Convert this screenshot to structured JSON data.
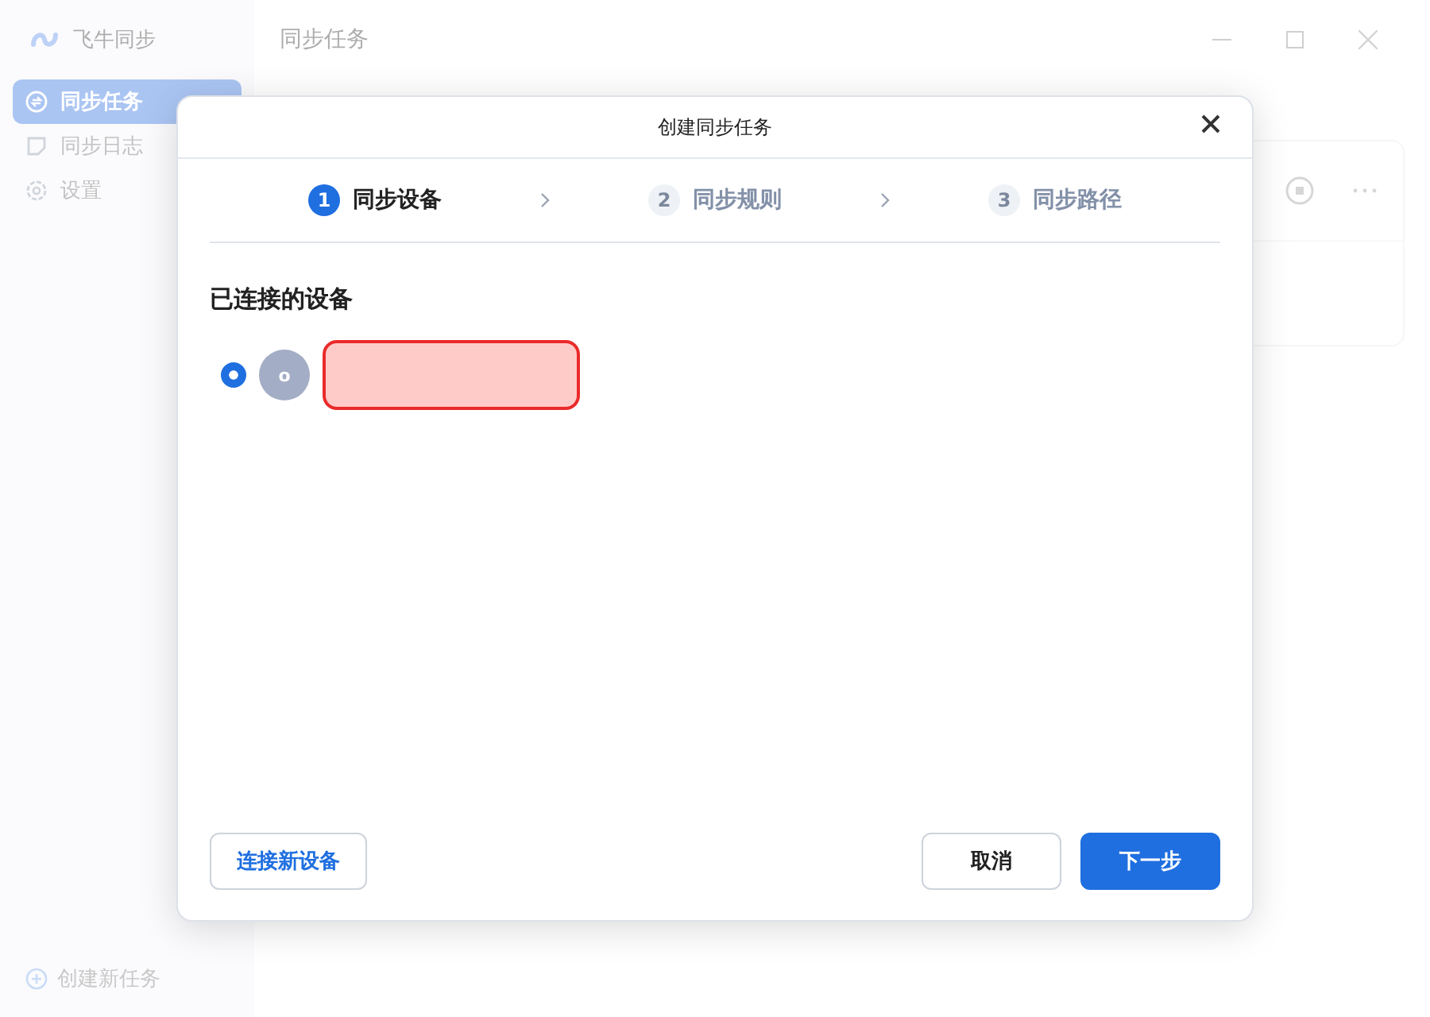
{
  "app": {
    "name": "飞牛同步"
  },
  "sidebar": {
    "items": [
      {
        "kind": "tasks",
        "label": "同步任务",
        "selected": true
      },
      {
        "kind": "log",
        "label": "同步日志",
        "selected": false
      },
      {
        "kind": "settings",
        "label": "设置",
        "selected": false
      }
    ],
    "create_button": "创建新任务"
  },
  "page": {
    "title": "同步任务"
  },
  "dialog": {
    "title": "创建同步任务",
    "steps": [
      {
        "number": "1",
        "label": "同步设备",
        "selected": true
      },
      {
        "number": "2",
        "label": "同步规则",
        "selected": false
      },
      {
        "number": "3",
        "label": "同步路径",
        "selected": false
      }
    ],
    "section_title": "已连接的设备",
    "devices": [
      {
        "avatar": "o",
        "selected": true
      }
    ],
    "buttons": {
      "connect": "连接新设备",
      "cancel": "取消",
      "next": "下一步"
    }
  }
}
